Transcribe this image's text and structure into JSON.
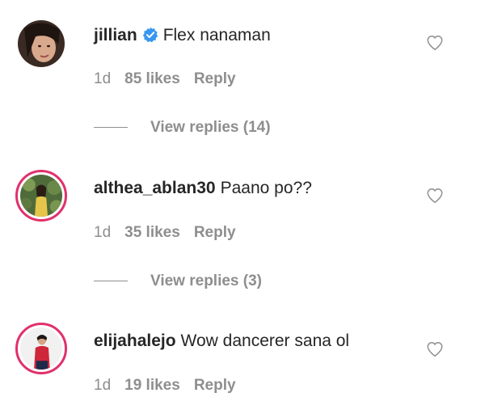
{
  "comments": [
    {
      "username": "jillian",
      "verified": true,
      "text": "Flex nanaman",
      "time": "1d",
      "likes": "85 likes",
      "reply": "Reply",
      "view_replies": "View replies (14)"
    },
    {
      "username": "althea_ablan30",
      "verified": false,
      "text": "Paano po??",
      "time": "1d",
      "likes": "35 likes",
      "reply": "Reply",
      "view_replies": "View replies (3)"
    },
    {
      "username": "elijahalejo",
      "verified": false,
      "text": "Wow dancerer sana ol",
      "time": "1d",
      "likes": "19 likes",
      "reply": "Reply"
    }
  ],
  "colors": {
    "verified_blue": "#3897f0",
    "story_ring": "#e1306c",
    "meta_gray": "#8e8e8e"
  },
  "icons": {
    "heart": "heart-outline-icon",
    "verified": "verified-badge-icon"
  }
}
